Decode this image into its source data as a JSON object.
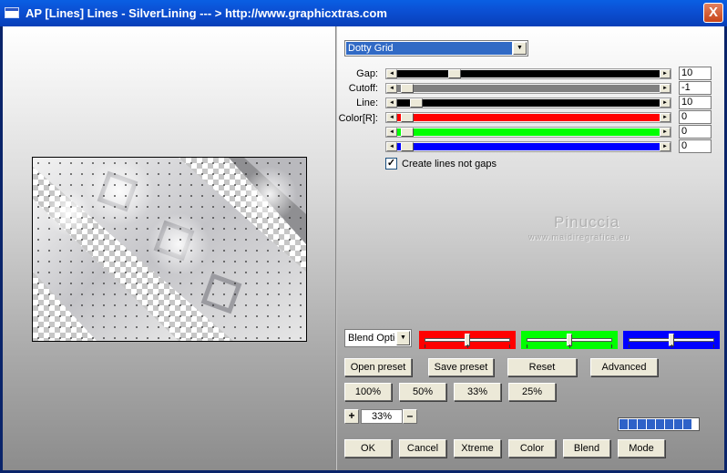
{
  "window": {
    "title": "AP [Lines]  Lines - SilverLining     --- > http://www.graphicxtras.com",
    "close_label": "X"
  },
  "preset_combo": {
    "value": "Dotty Grid",
    "arrow": "▼"
  },
  "sliders": [
    {
      "label": "Gap:",
      "value": "10",
      "track_color": "#000000",
      "fill_fraction": 0.2
    },
    {
      "label": "Cutoff:",
      "value": "-1",
      "track_color": "#808080",
      "fill_fraction": 0.0
    },
    {
      "label": "Line:",
      "value": "10",
      "track_color": "#000000",
      "fill_fraction": 0.03
    },
    {
      "label": "Color[R]:",
      "value": "0",
      "track_color": "#ff0000",
      "fill_fraction": 0.0
    },
    {
      "label": "",
      "value": "0",
      "track_color": "#00ff00",
      "fill_fraction": 0.0
    },
    {
      "label": "",
      "value": "0",
      "track_color": "#0000ff",
      "fill_fraction": 0.0
    }
  ],
  "scroll_arrows": {
    "left": "◄",
    "right": "►"
  },
  "checkbox": {
    "label": "Create lines not gaps",
    "checked": true,
    "mark": "✓"
  },
  "watermark": {
    "line1": "Pinuccia",
    "line2": "www.maidiregrafica.eu"
  },
  "blend_combo": {
    "value": "Blend Optio",
    "arrow": "▼"
  },
  "color_panels": [
    {
      "name": "red",
      "color": "#ff0000",
      "level": 0.5
    },
    {
      "name": "green",
      "color": "#00ff00",
      "level": 0.5
    },
    {
      "name": "blue",
      "color": "#0000ff",
      "level": 0.5
    }
  ],
  "buttons_row1": {
    "open_preset": "Open preset",
    "save_preset": "Save preset",
    "reset": "Reset",
    "advanced": "Advanced"
  },
  "buttons_row2": {
    "zoom_100": "100%",
    "zoom_50": "50%",
    "zoom_33": "33%",
    "zoom_25": "25%"
  },
  "zoom": {
    "plus": "+",
    "value": "33%",
    "minus": "–"
  },
  "progress": {
    "segments": 9
  },
  "buttons_bottom": {
    "ok": "OK",
    "cancel": "Cancel",
    "xtreme": "Xtreme",
    "color": "Color",
    "blend": "Blend",
    "mode": "Mode"
  }
}
